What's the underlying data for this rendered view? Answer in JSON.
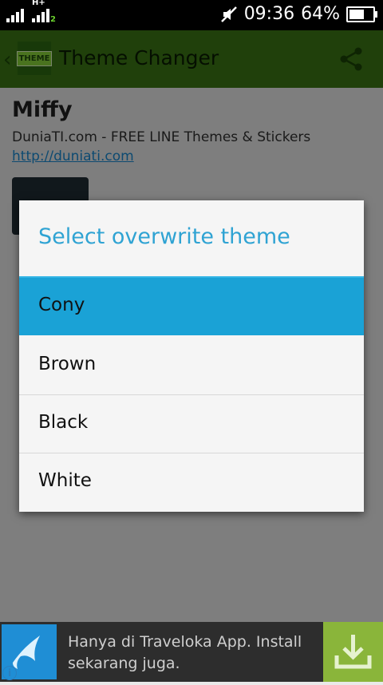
{
  "status_bar": {
    "time": "09:36",
    "battery": "64%",
    "network_label": "H+",
    "sim2_label": "2",
    "battery_level": 0.64
  },
  "action_bar": {
    "logo_text": "THEME",
    "title": "Theme Changer"
  },
  "theme": {
    "name": "Miffy",
    "description": "DuniaTI.com - FREE LINE Themes & Stickers",
    "link": "http://duniati.com"
  },
  "dialog": {
    "title": "Select overwrite theme",
    "options": [
      {
        "label": "Cony",
        "selected": true
      },
      {
        "label": "Brown",
        "selected": false
      },
      {
        "label": "Black",
        "selected": false
      },
      {
        "label": "White",
        "selected": false
      }
    ]
  },
  "ad": {
    "text": "Hanya di Traveloka App. Install sekarang juga.",
    "info_icon": "i"
  },
  "colors": {
    "action_bar": "#3e7c16",
    "dialog_title": "#2fa3d3",
    "selected_option": "#1aa2d6",
    "ad_download": "#8ab53a"
  }
}
